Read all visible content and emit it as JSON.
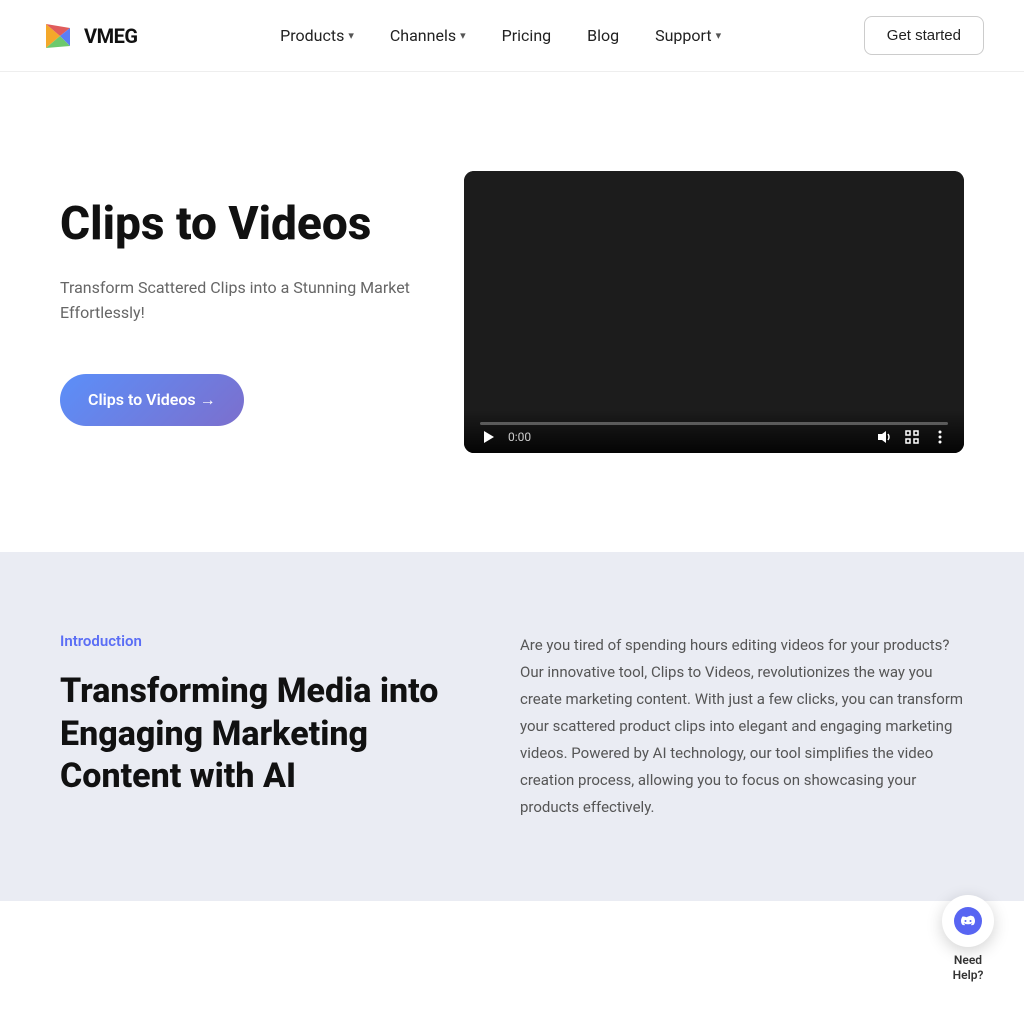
{
  "brand": {
    "name": "VMEG"
  },
  "navbar": {
    "logo_text": "VMEG",
    "cta_label": "Get started",
    "nav_items": [
      {
        "id": "products",
        "label": "Products",
        "has_dropdown": true
      },
      {
        "id": "channels",
        "label": "Channels",
        "has_dropdown": true
      },
      {
        "id": "pricing",
        "label": "Pricing",
        "has_dropdown": false
      },
      {
        "id": "blog",
        "label": "Blog",
        "has_dropdown": false
      },
      {
        "id": "support",
        "label": "Support",
        "has_dropdown": true
      }
    ]
  },
  "hero": {
    "title": "Clips to Videos",
    "subtitle": "Transform Scattered Clips into a Stunning Market Effortlessly!",
    "cta_label": "Clips to Videos →",
    "video_time": "0:00"
  },
  "intro": {
    "tag": "Introduction",
    "heading": "Transforming Media into Engaging Marketing Content with AI",
    "body": "Are you tired of spending hours editing videos for your products? Our innovative tool, Clips to Videos, revolutionizes the way you create marketing content. With just a few clicks, you can transform your scattered product clips into elegant and engaging marketing videos. Powered by AI technology, our tool simplifies the video creation process, allowing you to focus on showcasing your products effectively."
  },
  "chat_widget": {
    "label": "Need\nHelp?"
  }
}
